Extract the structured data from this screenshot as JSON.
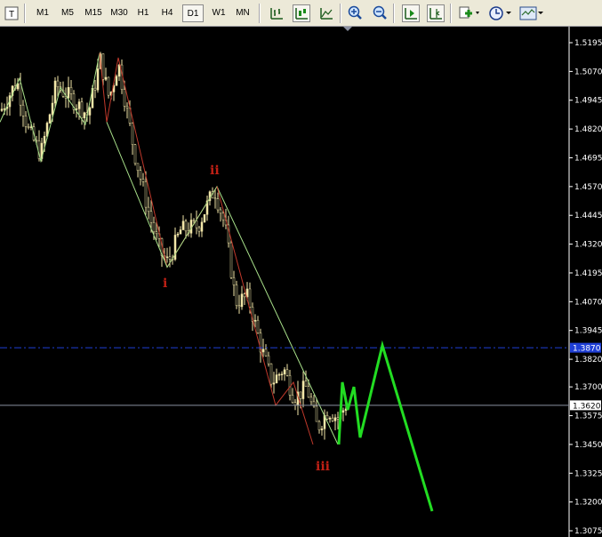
{
  "toolbar": {
    "timeframes": [
      "M1",
      "M5",
      "M15",
      "M30",
      "H1",
      "H4",
      "D1",
      "W1",
      "MN"
    ],
    "active_timeframe": "D1",
    "icons": [
      "text-icon",
      "bar-chart-icon",
      "candlestick-icon",
      "line-chart-icon",
      "zoom-in-icon",
      "zoom-out-icon",
      "auto-scroll-icon",
      "chart-shift-icon",
      "new-order-icon",
      "periods-icon",
      "templates-icon"
    ]
  },
  "colors": {
    "background": "#000000",
    "candle_up": "#f2e6a8",
    "candle_down": "#f2e6a8",
    "wave_line_red": "#c0392b",
    "wave_line_green": "#a8e08a",
    "projection": "#22dd22",
    "level_line": "#1f3fd6",
    "price_line": "#8a8fa0",
    "wave_label": "#c02015"
  },
  "chart": {
    "price_labels": [
      "1.5195",
      "1.5070",
      "1.4945",
      "1.4820",
      "1.4695",
      "1.4570",
      "1.4445",
      "1.4320",
      "1.4195",
      "1.4070",
      "1.3945",
      "1.3820",
      "1.3700",
      "1.3575",
      "1.3450",
      "1.3325",
      "1.3200",
      "1.3075"
    ],
    "current_price": "1.3620",
    "level_price_label": "1.3870",
    "wave_labels": [
      "i",
      "ii",
      "iii"
    ]
  },
  "chart_data": {
    "type": "candlestick",
    "y_ticks": [
      1.5195,
      1.507,
      1.4945,
      1.482,
      1.4695,
      1.457,
      1.4445,
      1.432,
      1.4195,
      1.407,
      1.3945,
      1.382,
      1.37,
      1.3575,
      1.345,
      1.3325,
      1.32,
      1.3075
    ],
    "ylim": [
      1.3075,
      1.5195
    ],
    "current_price": 1.362,
    "horizontal_level": 1.387,
    "wave_points": [
      {
        "label": "i",
        "price": 1.422
      },
      {
        "label": "ii",
        "price": 1.457
      },
      {
        "label": "iii",
        "price": 1.345
      }
    ],
    "projection_path_prices": [
      1.345,
      1.372,
      1.36,
      1.37,
      1.348,
      1.388,
      1.316
    ]
  }
}
